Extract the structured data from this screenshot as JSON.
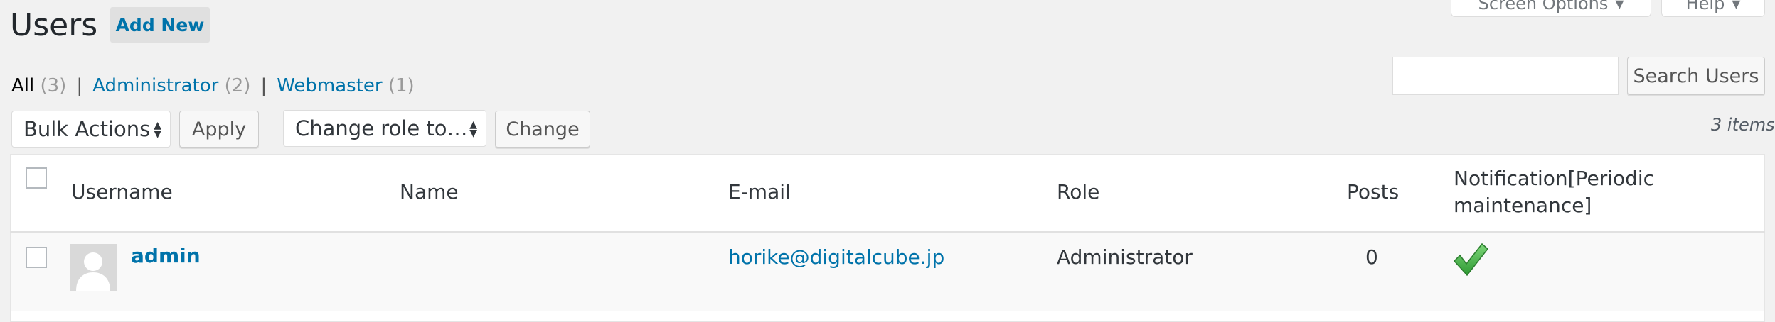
{
  "header": {
    "title": "Users",
    "add_new_label": "Add New",
    "screen_options_label": "Screen Options",
    "help_label": "Help"
  },
  "filters": {
    "all_label": "All",
    "all_count": "(3)",
    "separator": "|",
    "administrator_label": "Administrator",
    "administrator_count": "(2)",
    "webmaster_label": "Webmaster",
    "webmaster_count": "(1)"
  },
  "search": {
    "button_label": "Search Users",
    "input_value": ""
  },
  "bulk_actions": {
    "select_value": "Bulk Actions",
    "apply_label": "Apply"
  },
  "change_role": {
    "select_value": "Change role to…",
    "change_label": "Change"
  },
  "items_count": "3 items",
  "table": {
    "columns": [
      "Username",
      "Name",
      "E-mail",
      "Role",
      "Posts",
      "Notification[Periodic maintenance]"
    ],
    "rows": [
      {
        "username": "admin",
        "name": "",
        "email": "horike@digitalcube.jp",
        "role": "Administrator",
        "posts": "0",
        "notification_icon": "checkmark-icon"
      }
    ]
  },
  "colors": {
    "accent": "#0073aa",
    "background": "#f1f1f1",
    "check_green": "#46b450"
  }
}
